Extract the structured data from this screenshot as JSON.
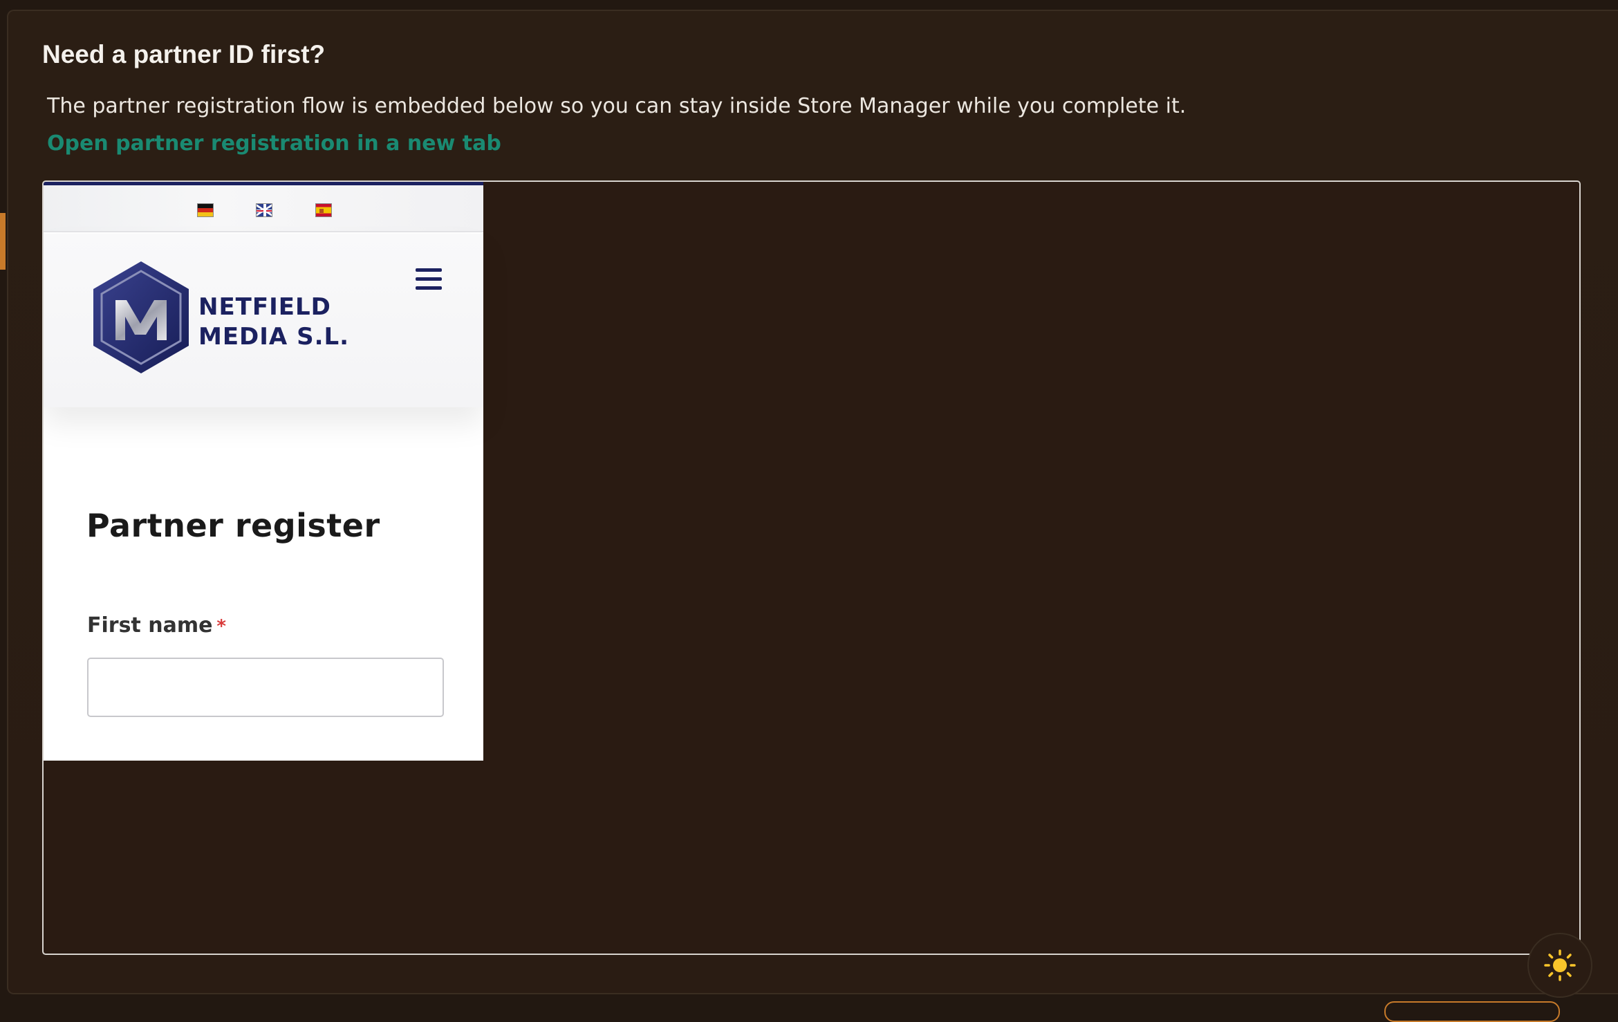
{
  "panel": {
    "title": "Need a partner ID first?",
    "description": "The partner registration flow is embedded below so you can stay inside Store Manager while you complete it.",
    "new_tab_link": "Open partner registration in a new tab"
  },
  "embedded_site": {
    "languages": [
      {
        "code": "de",
        "icon": "germany-flag-icon"
      },
      {
        "code": "en",
        "icon": "uk-flag-icon"
      },
      {
        "code": "es",
        "icon": "spain-flag-icon"
      }
    ],
    "logo": {
      "text_line_1": "NETFIELD",
      "text_line_2": "MEDIA S.L.",
      "monogram": "NM"
    },
    "menu_icon": "hamburger-icon",
    "page_title": "Partner register",
    "form": {
      "first_name_label": "First name",
      "required_marker": "*",
      "first_name_value": ""
    }
  },
  "theme_toggle": {
    "icon": "sun-icon"
  },
  "colors": {
    "background": "#221811",
    "link": "#1a8a72",
    "brand_navy": "#1b2160",
    "accent": "#c77a2a",
    "required": "#d93b3b"
  }
}
